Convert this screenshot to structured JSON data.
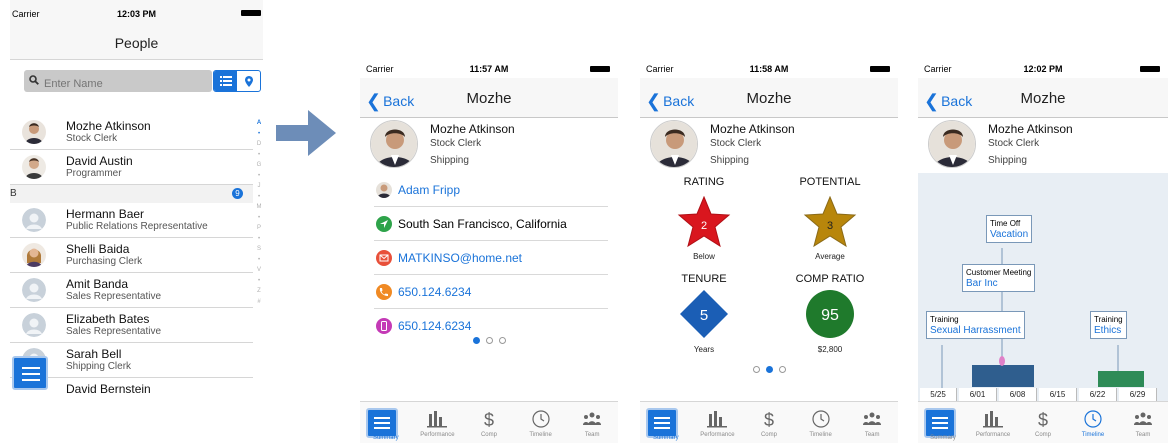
{
  "people_screen": {
    "carrier": "Carrier",
    "time": "12:03 PM",
    "title": "People",
    "search_placeholder": "Enter Name",
    "index_letters": [
      "A",
      "•",
      "D",
      "•",
      "G",
      "•",
      "J",
      "•",
      "M",
      "•",
      "P",
      "•",
      "S",
      "•",
      "V",
      "•",
      "Z",
      "#"
    ],
    "rows": [
      {
        "name": "Mozhe Atkinson",
        "job": "Stock Clerk"
      },
      {
        "name": "David Austin",
        "job": "Programmer"
      }
    ],
    "section": {
      "letter": "B",
      "count": "9"
    },
    "rows_b": [
      {
        "name": "Hermann Baer",
        "job": "Public Relations Representative"
      },
      {
        "name": "Shelli Baida",
        "job": "Purchasing Clerk"
      },
      {
        "name": "Amit Banda",
        "job": "Sales Representative"
      },
      {
        "name": "Elizabeth Bates",
        "job": "Sales Representative"
      },
      {
        "name": "Sarah Bell",
        "job": "Shipping Clerk"
      },
      {
        "name": "David Bernstein",
        "job": ""
      }
    ]
  },
  "detail_common": {
    "carrier": "Carrier",
    "back_label": "Back",
    "title": "Mozhe",
    "name": "Mozhe Atkinson",
    "job": "Stock Clerk",
    "dept": "Shipping",
    "tabs": [
      "Summary",
      "Performance",
      "Comp",
      "Timeline",
      "Team"
    ]
  },
  "summary_screen": {
    "time": "11:57 AM",
    "manager": "Adam Fripp",
    "location": "South San Francisco, California",
    "email": "MATKINSO@home.net",
    "phone1": "650.124.6234",
    "phone2": "650.124.6234"
  },
  "metrics_screen": {
    "time": "11:58 AM",
    "rating": {
      "label": "RATING",
      "value": "2",
      "sub": "Below"
    },
    "potential": {
      "label": "POTENTIAL",
      "value": "3",
      "sub": "Average"
    },
    "tenure": {
      "label": "TENURE",
      "value": "5",
      "sub": "Years"
    },
    "comp_ratio": {
      "label": "COMP RATIO",
      "value": "95",
      "sub": "$2,800"
    }
  },
  "timeline_screen": {
    "time": "12:02 PM",
    "events": [
      {
        "type": "Time Off",
        "value": "Vacation"
      },
      {
        "type": "Customer Meeting",
        "value": "Bar Inc"
      },
      {
        "type": "Training",
        "value": "Sexual Harrassment"
      },
      {
        "type": "Training",
        "value": "Ethics"
      }
    ],
    "dates": [
      "5/25",
      "6/01",
      "6/08",
      "6/15",
      "6/22",
      "6/29"
    ]
  },
  "colors": {
    "accent": "#1a73d9",
    "rating_red": "#d9161e",
    "potential_gold": "#b8860b",
    "tenure_blue": "#1b5eb5",
    "comp_green": "#1f7a2c",
    "timeline_blue_bar": "#2f5e8e",
    "timeline_green_bar": "#2e8b57"
  }
}
